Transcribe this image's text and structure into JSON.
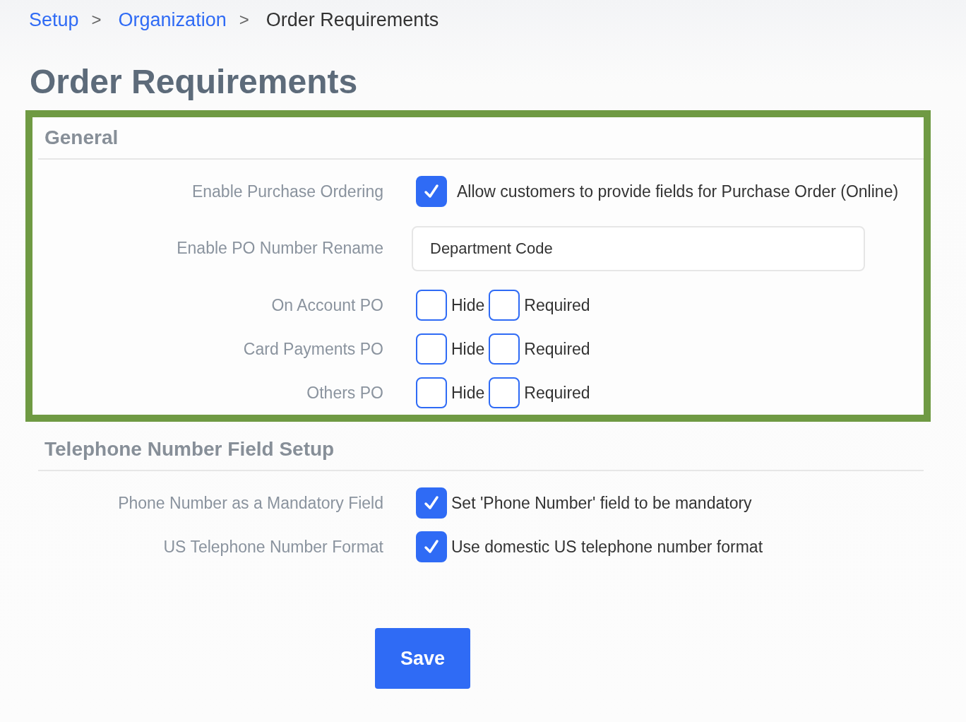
{
  "breadcrumb": [
    {
      "label": "Setup",
      "kind": "link"
    },
    {
      "label": "Organization",
      "kind": "link"
    },
    {
      "label": "Order Requirements",
      "kind": "current"
    }
  ],
  "separator": ">",
  "title": "Order Requirements",
  "sections": [
    {
      "title": "General",
      "highlighted": true,
      "rows": [
        {
          "kind": "checkbox",
          "label": "Enable Purchase Ordering",
          "option": {
            "label": "Allow customers to provide fields for Purchase Order (Online)",
            "checked": true
          }
        },
        {
          "kind": "text",
          "label": "Enable PO Number Rename",
          "value": "Department Code"
        },
        {
          "kind": "pair",
          "label": "On Account PO",
          "options": [
            {
              "label": "Hide",
              "checked": false
            },
            {
              "label": "Required",
              "checked": false
            }
          ]
        },
        {
          "kind": "pair",
          "label": "Card Payments PO",
          "options": [
            {
              "label": "Hide",
              "checked": false
            },
            {
              "label": "Required",
              "checked": false
            }
          ]
        },
        {
          "kind": "pair",
          "label": "Others PO",
          "options": [
            {
              "label": "Hide",
              "checked": false
            },
            {
              "label": "Required",
              "checked": false
            }
          ]
        }
      ]
    },
    {
      "title": "Telephone Number Field Setup",
      "highlighted": false,
      "rows": [
        {
          "kind": "checkbox",
          "label": "Phone Number as a Mandatory Field",
          "option": {
            "label": "Set 'Phone Number' field to be mandatory",
            "checked": true
          }
        },
        {
          "kind": "checkbox",
          "label": "US Telephone Number Format",
          "option": {
            "label": "Use domestic US telephone number format",
            "checked": true
          }
        }
      ]
    }
  ],
  "save": "Save"
}
